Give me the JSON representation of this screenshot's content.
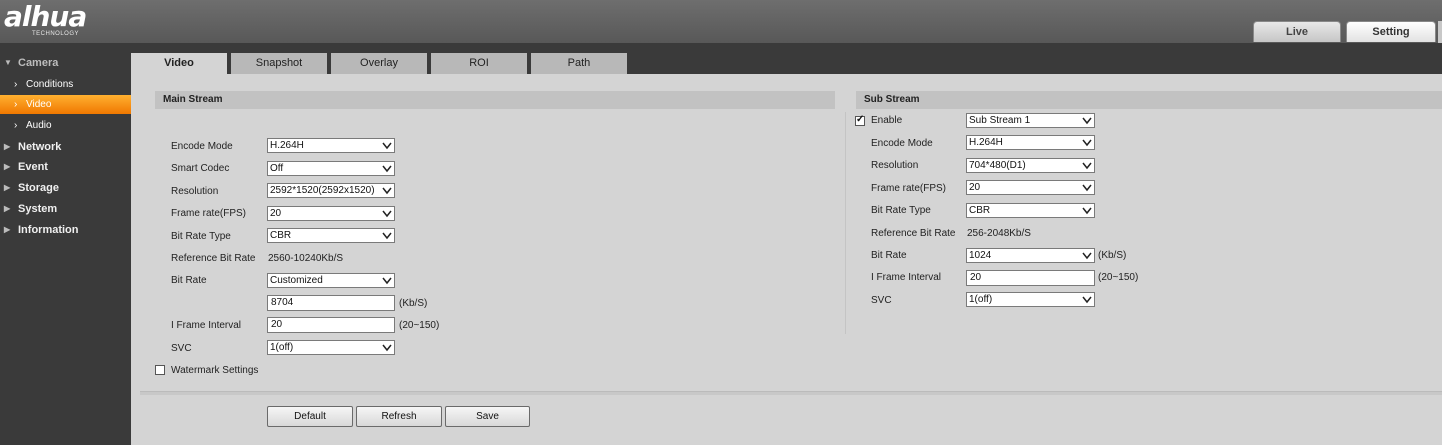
{
  "header": {
    "logo_text": "alhua",
    "logo_sub": "TECHNOLOGY",
    "tabs": [
      {
        "label": "Live"
      },
      {
        "label": "Setting"
      }
    ]
  },
  "sidebar": {
    "camera": "Camera",
    "camera_items": [
      {
        "label": "Conditions"
      },
      {
        "label": "Video"
      },
      {
        "label": "Audio"
      }
    ],
    "sections": [
      {
        "label": "Network"
      },
      {
        "label": "Event"
      },
      {
        "label": "Storage"
      },
      {
        "label": "System"
      },
      {
        "label": "Information"
      }
    ]
  },
  "tabs": [
    {
      "label": "Video"
    },
    {
      "label": "Snapshot"
    },
    {
      "label": "Overlay"
    },
    {
      "label": "ROI"
    },
    {
      "label": "Path"
    }
  ],
  "main_stream": {
    "title": "Main Stream",
    "encode_mode_label": "Encode Mode",
    "encode_mode": "H.264H",
    "smart_codec_label": "Smart Codec",
    "smart_codec": "Off",
    "resolution_label": "Resolution",
    "resolution": "2592*1520(2592x1520)",
    "frame_rate_label": "Frame rate(FPS)",
    "frame_rate": "20",
    "bit_rate_type_label": "Bit Rate Type",
    "bit_rate_type": "CBR",
    "ref_bit_rate_label": "Reference Bit Rate",
    "ref_bit_rate": "2560-10240Kb/S",
    "bit_rate_label": "Bit Rate",
    "bit_rate": "Customized",
    "bit_rate_custom": "8704",
    "bit_rate_unit": "(Kb/S)",
    "i_frame_label": "I Frame Interval",
    "i_frame": "20",
    "i_frame_range": "(20~150)",
    "svc_label": "SVC",
    "svc": "1(off)",
    "watermark_label": "Watermark Settings"
  },
  "sub_stream": {
    "title": "Sub Stream",
    "enable_label": "Enable",
    "enable": "Sub Stream 1",
    "encode_mode_label": "Encode Mode",
    "encode_mode": "H.264H",
    "resolution_label": "Resolution",
    "resolution": "704*480(D1)",
    "frame_rate_label": "Frame rate(FPS)",
    "frame_rate": "20",
    "bit_rate_type_label": "Bit Rate Type",
    "bit_rate_type": "CBR",
    "ref_bit_rate_label": "Reference Bit Rate",
    "ref_bit_rate": "256-2048Kb/S",
    "bit_rate_label": "Bit Rate",
    "bit_rate": "1024",
    "bit_rate_unit": "(Kb/S)",
    "i_frame_label": "I Frame Interval",
    "i_frame": "20",
    "i_frame_range": "(20~150)",
    "svc_label": "SVC",
    "svc": "1(off)"
  },
  "buttons": {
    "default": "Default",
    "refresh": "Refresh",
    "save": "Save"
  },
  "colors": {
    "accent": "#f28a10",
    "header_bg": "#626262",
    "sidebar_bg": "#3a3a3a",
    "panel_bg": "#d4d4d4"
  }
}
